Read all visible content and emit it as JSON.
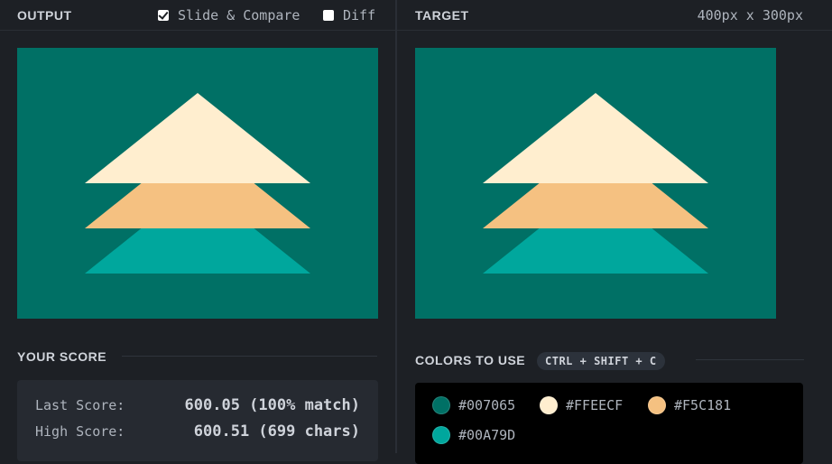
{
  "output": {
    "title": "OUTPUT",
    "slide_compare_label": "Slide & Compare",
    "slide_compare_checked": true,
    "diff_label": "Diff",
    "diff_checked": false
  },
  "target": {
    "title": "TARGET",
    "dimensions": "400px x 300px"
  },
  "score": {
    "title": "YOUR SCORE",
    "last_label": "Last Score:",
    "last_value": "600.05 (100% match)",
    "high_label": "High Score:",
    "high_value": "600.51 (699 chars)"
  },
  "colors": {
    "title": "COLORS TO USE",
    "shortcut": "CTRL + SHIFT + C",
    "swatches": [
      {
        "hex": "#007065",
        "label": "#007065"
      },
      {
        "hex": "#FFEECF",
        "label": "#FFEECF"
      },
      {
        "hex": "#F5C181",
        "label": "#F5C181"
      },
      {
        "hex": "#00A79D",
        "label": "#00A79D"
      }
    ]
  }
}
